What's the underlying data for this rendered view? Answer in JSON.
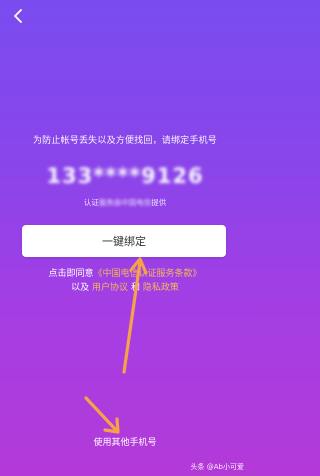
{
  "header": {
    "back_icon": "chevron-left-icon"
  },
  "main": {
    "description": "为防止帐号丢失以及方便找回，请绑定手机号",
    "phone_masked": "133****9126",
    "auth_prefix": "认证",
    "auth_blurred": "服务由中国电信",
    "auth_suffix": "提供",
    "bind_button": "一键绑定",
    "agree_text_1": "点击即同意",
    "agree_link_1": "《中国电信认证服务条款》",
    "agree_text_2": "以及",
    "agree_link_2": "用户协议",
    "agree_text_3": "和",
    "agree_link_3": "隐私政策"
  },
  "footer": {
    "other_phone": "使用其他手机号",
    "watermark": "头条 @Ab小可爱"
  },
  "colors": {
    "bg_top": "#7a4cf0",
    "bg_bottom": "#b43ad8",
    "link": "#f6b85a",
    "arrow": "#f5a24a"
  }
}
